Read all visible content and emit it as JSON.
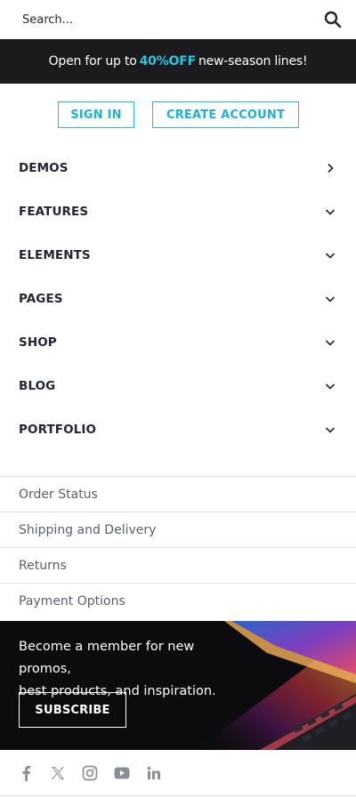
{
  "search": {
    "placeholder": "Search...",
    "icon": "search-icon"
  },
  "promo": {
    "before": "Open for up to",
    "highlight": "40%OFF",
    "after": "new-season lines!",
    "highlight_color": "#2ec4e2",
    "background": "#1b1b1d"
  },
  "auth": {
    "sign_in": "SIGN IN",
    "create_account": "CREATE ACCOUNT",
    "accent": "#2cb9d8"
  },
  "menu": {
    "items": [
      {
        "label": "DEMOS",
        "icon": "chevron-right-icon"
      },
      {
        "label": "FEATURES",
        "icon": "chevron-down-icon"
      },
      {
        "label": "ELEMENTS",
        "icon": "chevron-down-icon"
      },
      {
        "label": "PAGES",
        "icon": "chevron-down-icon"
      },
      {
        "label": "SHOP",
        "icon": "chevron-down-icon"
      },
      {
        "label": "BLOG",
        "icon": "chevron-down-icon"
      },
      {
        "label": "PORTFOLIO",
        "icon": "chevron-down-icon"
      }
    ]
  },
  "links": {
    "items": [
      "Order Status",
      "Shipping and Delivery",
      "Returns",
      "Payment Options"
    ]
  },
  "banner": {
    "line1": "Become a member for new promos,",
    "line2": "best products, and inspiration.",
    "button": "SUBSCRIBE"
  },
  "social": {
    "icons": [
      "facebook-icon",
      "x-icon",
      "instagram-icon",
      "youtube-icon",
      "linkedin-icon"
    ]
  }
}
